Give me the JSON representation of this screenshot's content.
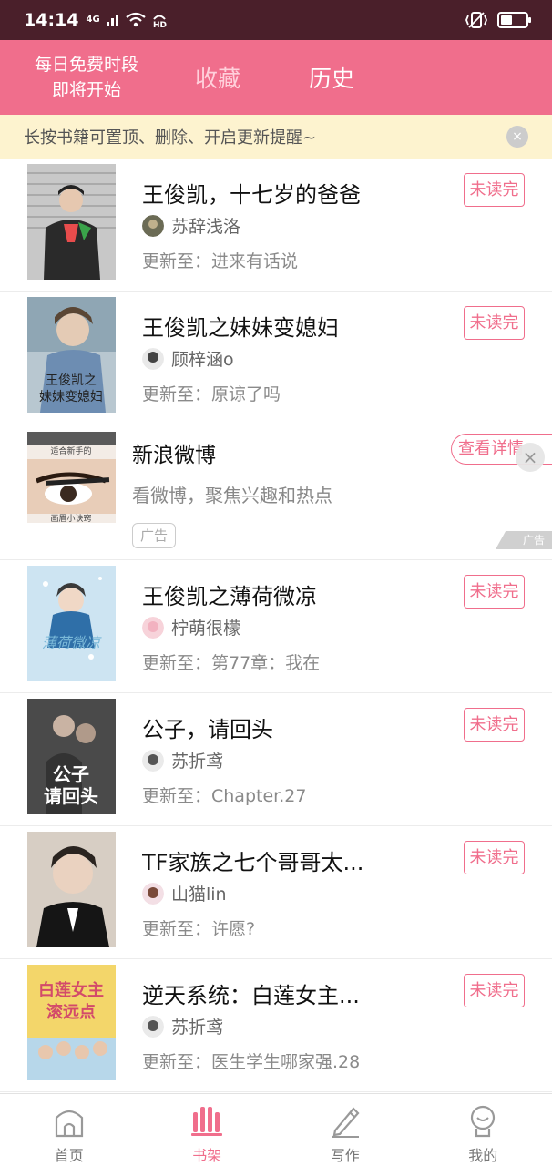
{
  "status_bar": {
    "time": "14:14",
    "network": "4G",
    "battery_level": 0.45
  },
  "header": {
    "free_slot_line1": "每日免费时段",
    "free_slot_line2": "即将开始",
    "tabs": [
      {
        "label": "收藏",
        "active": false
      },
      {
        "label": "历史",
        "active": true
      }
    ]
  },
  "tip": {
    "text": "长按书籍可置顶、删除、开启更新提醒~",
    "close": "×"
  },
  "books": [
    {
      "title": "王俊凯，十七岁的爸爸",
      "author": "苏辞浅洛",
      "update": "更新至：进来有话说",
      "status": "未读完",
      "cover_text": ""
    },
    {
      "title": "王俊凯之妹妹变媳妇",
      "author": "顾梓涵o",
      "update": "更新至：原谅了吗",
      "status": "未读完",
      "cover_text": "王俊凯之妹妹变媳妇"
    },
    {
      "title": "王俊凯之薄荷微凉",
      "author": "柠萌很檬",
      "update": "更新至：第77章：我在",
      "status": "未读完",
      "cover_text": "薄荷微凉"
    },
    {
      "title": "公子，请回头",
      "author": "苏折鸢",
      "update": "更新至：Chapter.27",
      "status": "未读完",
      "cover_text": "公子请回头"
    },
    {
      "title": "TF家族之七个哥哥太...",
      "author": "山猫lin",
      "update": "更新至：许愿?",
      "status": "未读完",
      "cover_text": ""
    },
    {
      "title": "逆天系统：白莲女主...",
      "author": "苏折鸢",
      "update": "更新至：医生学生哪家强.28",
      "status": "未读完",
      "cover_text": "白莲女主滚远点"
    }
  ],
  "ad": {
    "title": "新浪微博",
    "desc": "看微博，聚焦兴趣和热点",
    "tag": "广告",
    "button": "查看详情",
    "close": "×",
    "mark": "广告",
    "image_top_text": "适合新手的",
    "image_bottom_text": "画眉小诀窍"
  },
  "nav": [
    {
      "label": "首页",
      "icon": "home-icon",
      "active": false
    },
    {
      "label": "书架",
      "icon": "bookshelf-icon",
      "active": true
    },
    {
      "label": "写作",
      "icon": "pencil-icon",
      "active": false
    },
    {
      "label": "我的",
      "icon": "profile-icon",
      "active": false
    }
  ],
  "colors": {
    "accent": "#f06e8c",
    "statusbar": "#4a1f2a",
    "tip_bg": "#fdf3cf"
  }
}
